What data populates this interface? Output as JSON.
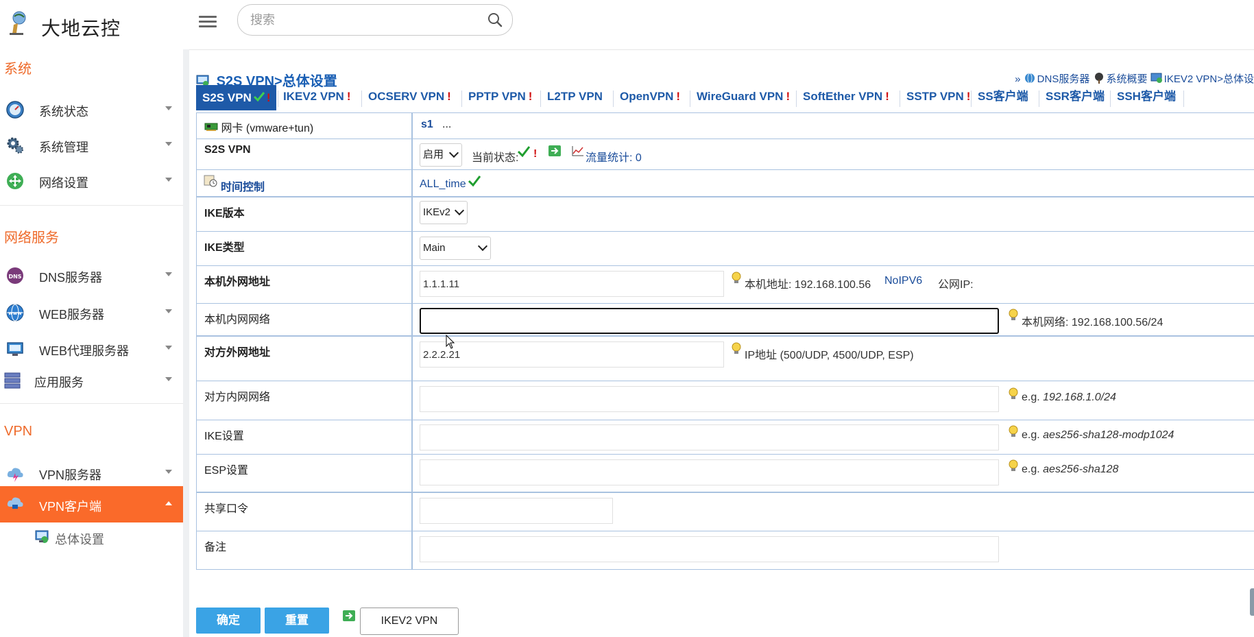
{
  "app": {
    "brand": "大地云控"
  },
  "search": {
    "placeholder": "搜索"
  },
  "sidebar": {
    "sections": [
      {
        "title": "系统"
      },
      {
        "title": "网络服务"
      },
      {
        "title": "VPN"
      }
    ],
    "items": [
      {
        "label": "系统状态",
        "icon": "dashboard-icon"
      },
      {
        "label": "系统管理",
        "icon": "gear-icon"
      },
      {
        "label": "网络设置",
        "icon": "network-icon"
      },
      {
        "label": "DNS服务器",
        "icon": "dns-icon"
      },
      {
        "label": "WEB服务器",
        "icon": "www-icon"
      },
      {
        "label": "WEB代理服务器",
        "icon": "monitor-icon"
      },
      {
        "label": "应用服务",
        "icon": "server-icon"
      },
      {
        "label": "VPN服务器",
        "icon": "cloud-icon"
      },
      {
        "label": "VPN客户端",
        "icon": "cloud-client-icon"
      }
    ],
    "sub_item": {
      "label": "总体设置"
    }
  },
  "page": {
    "title": "S2S VPN>总体设置",
    "quick_links": {
      "prefix": "»",
      "dns": "DNS服务器",
      "overview": "系统概要",
      "ikev2": "IKEV2 VPN>总体设"
    }
  },
  "tabs": [
    {
      "label": "S2S VPN",
      "bang": "!"
    },
    {
      "label": "IKEV2 VPN",
      "bang": "!"
    },
    {
      "label": "OCSERV VPN",
      "bang": "!"
    },
    {
      "label": "PPTP VPN",
      "bang": "!"
    },
    {
      "label": "L2TP VPN",
      "bang": ""
    },
    {
      "label": "OpenVPN",
      "bang": "!"
    },
    {
      "label": "WireGuard VPN",
      "bang": "!"
    },
    {
      "label": "SoftEther VPN",
      "bang": "!"
    },
    {
      "label": "SSTP VPN",
      "bang": "!"
    },
    {
      "label": "SS客户端",
      "bang": ""
    },
    {
      "label": "SSR客户端",
      "bang": ""
    },
    {
      "label": "SSH客户端",
      "bang": ""
    }
  ],
  "form": {
    "nic": {
      "label": "网卡",
      "label_suffix": "(vmware+tun)",
      "value": "s1",
      "more": "..."
    },
    "s2s": {
      "label": "S2S VPN",
      "select": "启用",
      "status_label": "当前状态:",
      "status_bang": "!",
      "traffic": "流量统计: 0"
    },
    "time": {
      "label": "时间控制",
      "value": "ALL_time"
    },
    "ike_version": {
      "label": "IKE版本",
      "select": "IKEv2"
    },
    "ike_type": {
      "label": "IKE类型",
      "select": "Main"
    },
    "local_wan": {
      "label": "本机外网地址",
      "value": "1.1.1.11",
      "hint": "本机地址: 192.168.100.56",
      "noipv6": "NoIPV6",
      "public": "公网IP:"
    },
    "local_lan": {
      "label": "本机内网网络",
      "value": "",
      "hint": "本机网络: 192.168.100.56/24"
    },
    "remote_wan": {
      "label": "对方外网地址",
      "value": "2.2.2.21",
      "hint": "IP地址 (500/UDP, 4500/UDP, ESP)"
    },
    "remote_lan": {
      "label": "对方内网网络",
      "value": "",
      "hint_prefix": "e.g.",
      "hint_example": "192.168.1.0/24"
    },
    "ike_settings": {
      "label": "IKE设置",
      "value": "",
      "hint_prefix": "e.g.",
      "hint_example": "aes256-sha128-modp1024"
    },
    "esp_settings": {
      "label": "ESP设置",
      "value": "",
      "hint_prefix": "e.g.",
      "hint_example": "aes256-sha128"
    },
    "psk": {
      "label": "共享口令",
      "value": ""
    },
    "note": {
      "label": "备注",
      "value": ""
    }
  },
  "buttons": {
    "ok": "确定",
    "reset": "重置",
    "ikev2": "IKEV2 VPN"
  },
  "colors": {
    "accent": "#fa6a2a",
    "link": "#1e5aa8",
    "button": "#3aa3e5",
    "error": "#d01010",
    "success": "#1f9e2f"
  }
}
